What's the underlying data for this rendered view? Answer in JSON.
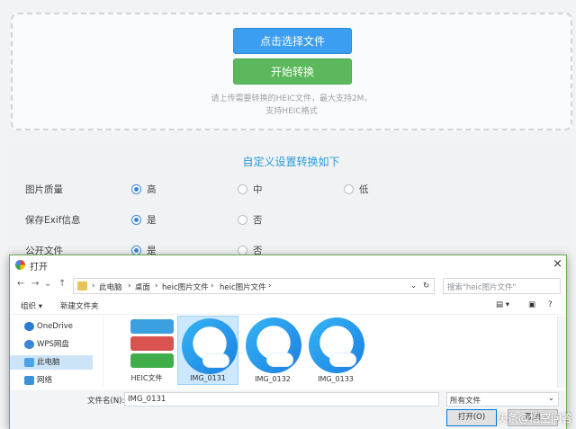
{
  "upload": {
    "select_button": "点击选择文件",
    "convert_button": "开始转换",
    "hint_line1": "请上传需要转换的HEIC文件，最大支持2M，",
    "hint_line2": "支持HEIC格式"
  },
  "settings": {
    "title": "自定义设置转换如下",
    "rows": [
      {
        "label": "图片质量",
        "options": [
          "高",
          "中",
          "低"
        ]
      },
      {
        "label": "保存Exif信息",
        "options": [
          "是",
          "否"
        ]
      },
      {
        "label": "公开文件",
        "options": [
          "是",
          "否"
        ]
      }
    ]
  },
  "dialog": {
    "title": "打开",
    "close": "×",
    "breadcrumb": [
      "此电脑",
      "桌面",
      "heic图片文件",
      "heic图片文件"
    ],
    "search_placeholder": "搜索\"heic图片文件\"",
    "toolbar": {
      "organize": "组织 ▾",
      "new_folder": "新建文件夹"
    },
    "nav": [
      "OneDrive",
      "WPS网盘",
      "此电脑",
      "网络"
    ],
    "files": [
      "HEIC文件",
      "IMG_0131",
      "IMG_0132",
      "IMG_0133"
    ],
    "filename_label": "文件名(N):",
    "filename_value": "IMG_0131",
    "filetype": "所有文件",
    "open_button": "打开(O)",
    "cancel_button": "取消"
  },
  "watermark": "头条@悟空问答",
  "colors": {
    "accent": "#3b9ef0",
    "green": "#5cb85c",
    "title": "#2a9bd8"
  }
}
